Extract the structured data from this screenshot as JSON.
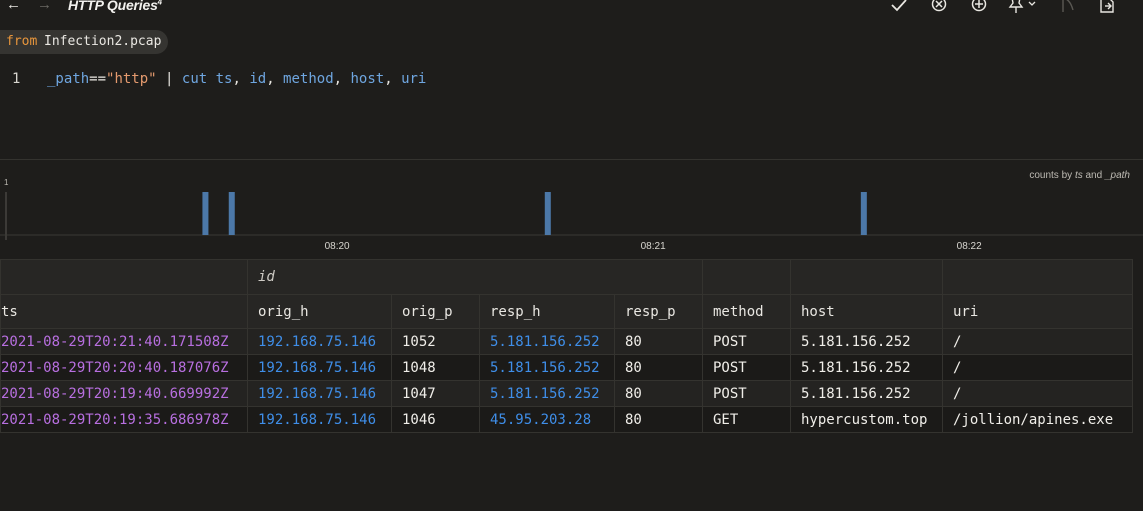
{
  "titlebar": {
    "title": "HTTP Queries",
    "title_badge": "4",
    "back_icon": "←",
    "forward_icon": "→",
    "icons": [
      "check-icon",
      "cancel-circle-icon",
      "add-circle-icon",
      "pin-icon",
      "chevron-down-icon",
      "flag-icon",
      "export-icon"
    ]
  },
  "from": {
    "keyword": "from",
    "file": "Infection2.pcap"
  },
  "editor": {
    "line_number": "1",
    "tokens": [
      {
        "text": "_path",
        "kind": "field"
      },
      {
        "text": "==",
        "kind": "op"
      },
      {
        "text": "\"http\"",
        "kind": "str"
      },
      {
        "text": " | ",
        "kind": "op"
      },
      {
        "text": "cut ts",
        "kind": "kw"
      },
      {
        "text": ", ",
        "kind": "op"
      },
      {
        "text": "id",
        "kind": "kw"
      },
      {
        "text": ", ",
        "kind": "op"
      },
      {
        "text": "method",
        "kind": "kw"
      },
      {
        "text": ", ",
        "kind": "op"
      },
      {
        "text": "host",
        "kind": "kw"
      },
      {
        "text": ", ",
        "kind": "op"
      },
      {
        "text": "uri",
        "kind": "kw"
      }
    ]
  },
  "chart_caption": {
    "prefix": "counts by",
    "field1": "ts",
    "and": "and",
    "field2": "_path"
  },
  "chart_data": {
    "type": "bar",
    "y_tick": "1",
    "x_ticks": [
      "08:20",
      "08:21",
      "08:22"
    ],
    "x_tick_seconds": [
      0,
      60,
      120
    ],
    "x_domain_seconds": [
      -64,
      153
    ],
    "bar_color": "#4c78a8",
    "bars": [
      {
        "t": "20:19:35",
        "seconds": -25,
        "count": 1
      },
      {
        "t": "20:19:40",
        "seconds": -20,
        "count": 1
      },
      {
        "t": "20:20:40",
        "seconds": 40,
        "count": 1
      },
      {
        "t": "20:21:40",
        "seconds": 100,
        "count": 1
      }
    ]
  },
  "table": {
    "group_header": "id",
    "columns": [
      "ts",
      "orig_h",
      "orig_p",
      "resp_h",
      "resp_p",
      "method",
      "host",
      "uri"
    ],
    "rows": [
      [
        "2021-08-29T20:21:40.171508Z",
        "192.168.75.146",
        "1052",
        "5.181.156.252",
        "80",
        "POST",
        "5.181.156.252",
        "/"
      ],
      [
        "2021-08-29T20:20:40.187076Z",
        "192.168.75.146",
        "1048",
        "5.181.156.252",
        "80",
        "POST",
        "5.181.156.252",
        "/"
      ],
      [
        "2021-08-29T20:19:40.669992Z",
        "192.168.75.146",
        "1047",
        "5.181.156.252",
        "80",
        "POST",
        "5.181.156.252",
        "/"
      ],
      [
        "2021-08-29T20:19:35.686978Z",
        "192.168.75.146",
        "1046",
        "45.95.203.28",
        "80",
        "GET",
        "hypercustom.top",
        "/jollion/apines.exe"
      ]
    ]
  },
  "colors": {
    "background": "#1e1d1b",
    "timestamp": "#b86fe0",
    "ip": "#3f8ee8",
    "from_keyword": "#e8963c"
  }
}
